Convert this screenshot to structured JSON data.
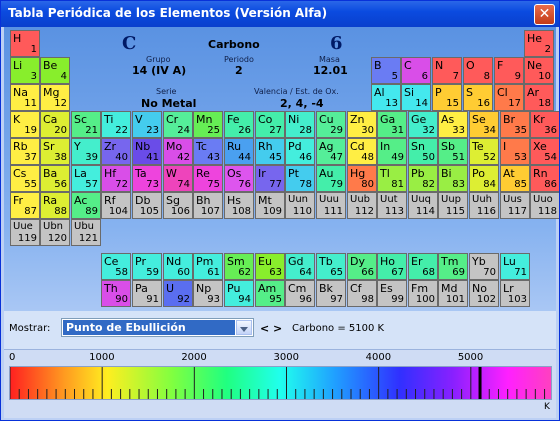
{
  "window": {
    "title": "Tabla Periódica de los Elementos (Versión Alfa)",
    "close_glyph": "✕"
  },
  "selected": {
    "symbol": "C",
    "name": "Carbono",
    "number": "6",
    "group_label": "Grupo",
    "group": "14 (IV A)",
    "period_label": "Periodo",
    "period": "2",
    "mass_label": "Masa",
    "mass": "12.01",
    "series_label": "Serie",
    "series": "No Metal",
    "valence_label": "Valencia / Est. de Ox.",
    "valence": "2, 4, -4"
  },
  "elements": [
    {
      "s": "H",
      "n": "1",
      "c": "#ff5a5a"
    },
    {
      "s": "He",
      "n": "2",
      "c": "#ff5a5a"
    },
    {
      "s": "Li",
      "n": "3",
      "c": "#88ee2c"
    },
    {
      "s": "Be",
      "n": "4",
      "c": "#88ee2c"
    },
    {
      "s": "B",
      "n": "5",
      "c": "#6a7cf3"
    },
    {
      "s": "C",
      "n": "6",
      "c": "#d94ee8"
    },
    {
      "s": "N",
      "n": "7",
      "c": "#ff5a5a"
    },
    {
      "s": "O",
      "n": "8",
      "c": "#ff5a5a"
    },
    {
      "s": "F",
      "n": "9",
      "c": "#ff5a5a"
    },
    {
      "s": "Ne",
      "n": "10",
      "c": "#ff5a5a"
    },
    {
      "s": "Na",
      "n": "11",
      "c": "#ffee44"
    },
    {
      "s": "Mg",
      "n": "12",
      "c": "#ffee44"
    },
    {
      "s": "Al",
      "n": "13",
      "c": "#44e8ee"
    },
    {
      "s": "Si",
      "n": "14",
      "c": "#44e8ee"
    },
    {
      "s": "P",
      "n": "15",
      "c": "#ffcc33"
    },
    {
      "s": "S",
      "n": "16",
      "c": "#ffcc33"
    },
    {
      "s": "Cl",
      "n": "17",
      "c": "#ff7a4a"
    },
    {
      "s": "Ar",
      "n": "18",
      "c": "#ff5a5a"
    },
    {
      "s": "K",
      "n": "19",
      "c": "#ffee44"
    },
    {
      "s": "Ca",
      "n": "20",
      "c": "#ddee33"
    },
    {
      "s": "Sc",
      "n": "21",
      "c": "#55ee88"
    },
    {
      "s": "Ti",
      "n": "22",
      "c": "#44eedd"
    },
    {
      "s": "V",
      "n": "23",
      "c": "#44ccee"
    },
    {
      "s": "Cr",
      "n": "24",
      "c": "#55ee99"
    },
    {
      "s": "Mn",
      "n": "25",
      "c": "#66ee55"
    },
    {
      "s": "Fe",
      "n": "26",
      "c": "#44eeaa"
    },
    {
      "s": "Co",
      "n": "27",
      "c": "#44eeaa"
    },
    {
      "s": "Ni",
      "n": "28",
      "c": "#44eecc"
    },
    {
      "s": "Cu",
      "n": "29",
      "c": "#55ee99"
    },
    {
      "s": "Zn",
      "n": "30",
      "c": "#ffee44"
    },
    {
      "s": "Ga",
      "n": "31",
      "c": "#55ee88"
    },
    {
      "s": "Ge",
      "n": "32",
      "c": "#44eecc"
    },
    {
      "s": "As",
      "n": "33",
      "c": "#ffee44"
    },
    {
      "s": "Se",
      "n": "34",
      "c": "#ffcc33"
    },
    {
      "s": "Br",
      "n": "35",
      "c": "#ff7a4a"
    },
    {
      "s": "Kr",
      "n": "36",
      "c": "#ff5a5a"
    },
    {
      "s": "Rb",
      "n": "37",
      "c": "#ffee44"
    },
    {
      "s": "Sr",
      "n": "38",
      "c": "#ddee33"
    },
    {
      "s": "Y",
      "n": "39",
      "c": "#44eecc"
    },
    {
      "s": "Zr",
      "n": "40",
      "c": "#7766ee"
    },
    {
      "s": "Nb",
      "n": "41",
      "c": "#6a4ce8"
    },
    {
      "s": "Mo",
      "n": "42",
      "c": "#d94ee8"
    },
    {
      "s": "Tc",
      "n": "43",
      "c": "#6a7cf3"
    },
    {
      "s": "Ru",
      "n": "44",
      "c": "#4aa0f0"
    },
    {
      "s": "Rh",
      "n": "45",
      "c": "#44ccee"
    },
    {
      "s": "Pd",
      "n": "46",
      "c": "#44eedd"
    },
    {
      "s": "Ag",
      "n": "47",
      "c": "#55ee99"
    },
    {
      "s": "Cd",
      "n": "48",
      "c": "#ffee44"
    },
    {
      "s": "In",
      "n": "49",
      "c": "#55ee88"
    },
    {
      "s": "Sn",
      "n": "50",
      "c": "#44eeaa"
    },
    {
      "s": "Sb",
      "n": "51",
      "c": "#55ee88"
    },
    {
      "s": "Te",
      "n": "52",
      "c": "#ddee33"
    },
    {
      "s": "I",
      "n": "53",
      "c": "#ff7a4a"
    },
    {
      "s": "Xe",
      "n": "54",
      "c": "#ff5a5a"
    },
    {
      "s": "Cs",
      "n": "55",
      "c": "#ffee44"
    },
    {
      "s": "Ba",
      "n": "56",
      "c": "#ddee33"
    },
    {
      "s": "La",
      "n": "57",
      "c": "#44eedd"
    },
    {
      "s": "Hf",
      "n": "72",
      "c": "#d94ee8"
    },
    {
      "s": "Ta",
      "n": "73",
      "c": "#ee44dd"
    },
    {
      "s": "W",
      "n": "74",
      "c": "#ee44bb"
    },
    {
      "s": "Re",
      "n": "75",
      "c": "#ee44dd"
    },
    {
      "s": "Os",
      "n": "76",
      "c": "#dd55ee"
    },
    {
      "s": "Ir",
      "n": "77",
      "c": "#7766ee"
    },
    {
      "s": "Pt",
      "n": "78",
      "c": "#44ccee"
    },
    {
      "s": "Au",
      "n": "79",
      "c": "#44eeaa"
    },
    {
      "s": "Hg",
      "n": "80",
      "c": "#ff7a4a"
    },
    {
      "s": "Tl",
      "n": "81",
      "c": "#99ee44"
    },
    {
      "s": "Pb",
      "n": "82",
      "c": "#99ee44"
    },
    {
      "s": "Bi",
      "n": "83",
      "c": "#99ee44"
    },
    {
      "s": "Po",
      "n": "84",
      "c": "#ddee33"
    },
    {
      "s": "At",
      "n": "85",
      "c": "#ffcc33"
    },
    {
      "s": "Rn",
      "n": "86",
      "c": "#ff5a5a"
    },
    {
      "s": "Fr",
      "n": "87",
      "c": "#ffee44"
    },
    {
      "s": "Ra",
      "n": "88",
      "c": "#ddee33"
    },
    {
      "s": "Ac",
      "n": "89",
      "c": "#55ee88"
    },
    {
      "s": "Rf",
      "n": "104",
      "c": "#c4c4c4"
    },
    {
      "s": "Db",
      "n": "105",
      "c": "#c4c4c4"
    },
    {
      "s": "Sg",
      "n": "106",
      "c": "#c4c4c4"
    },
    {
      "s": "Bh",
      "n": "107",
      "c": "#c4c4c4"
    },
    {
      "s": "Hs",
      "n": "108",
      "c": "#c4c4c4"
    },
    {
      "s": "Mt",
      "n": "109",
      "c": "#c4c4c4"
    },
    {
      "s": "Uun",
      "n": "110",
      "c": "#c4c4c4"
    },
    {
      "s": "Uuu",
      "n": "111",
      "c": "#c4c4c4"
    },
    {
      "s": "Uub",
      "n": "112",
      "c": "#c4c4c4"
    },
    {
      "s": "Uut",
      "n": "113",
      "c": "#c4c4c4"
    },
    {
      "s": "Uuq",
      "n": "114",
      "c": "#c4c4c4"
    },
    {
      "s": "Uup",
      "n": "115",
      "c": "#c4c4c4"
    },
    {
      "s": "Uuh",
      "n": "116",
      "c": "#c4c4c4"
    },
    {
      "s": "Uus",
      "n": "117",
      "c": "#c4c4c4"
    },
    {
      "s": "Uuo",
      "n": "118",
      "c": "#c4c4c4"
    },
    {
      "s": "Uue",
      "n": "119",
      "c": "#c4c4c4"
    },
    {
      "s": "Ubn",
      "n": "120",
      "c": "#c4c4c4"
    },
    {
      "s": "Ubu",
      "n": "121",
      "c": "#c4c4c4"
    },
    {
      "s": "Ce",
      "n": "58",
      "c": "#44eedd"
    },
    {
      "s": "Pr",
      "n": "59",
      "c": "#44eedd"
    },
    {
      "s": "Nd",
      "n": "60",
      "c": "#44eedd"
    },
    {
      "s": "Pm",
      "n": "61",
      "c": "#44eedd"
    },
    {
      "s": "Sm",
      "n": "62",
      "c": "#66ee55"
    },
    {
      "s": "Eu",
      "n": "63",
      "c": "#88ee2c"
    },
    {
      "s": "Gd",
      "n": "64",
      "c": "#44eecc"
    },
    {
      "s": "Tb",
      "n": "65",
      "c": "#44eecc"
    },
    {
      "s": "Dy",
      "n": "66",
      "c": "#55ee88"
    },
    {
      "s": "Ho",
      "n": "67",
      "c": "#44eeaa"
    },
    {
      "s": "Er",
      "n": "68",
      "c": "#44eeaa"
    },
    {
      "s": "Tm",
      "n": "69",
      "c": "#55ee88"
    },
    {
      "s": "Yb",
      "n": "70",
      "c": "#c4c4c4"
    },
    {
      "s": "Lu",
      "n": "71",
      "c": "#44eedd"
    },
    {
      "s": "Th",
      "n": "90",
      "c": "#d94ee8"
    },
    {
      "s": "Pa",
      "n": "91",
      "c": "#c4c4c4"
    },
    {
      "s": "U",
      "n": "92",
      "c": "#5a6ef0"
    },
    {
      "s": "Np",
      "n": "93",
      "c": "#c4c4c4"
    },
    {
      "s": "Pu",
      "n": "94",
      "c": "#44eedd"
    },
    {
      "s": "Am",
      "n": "95",
      "c": "#55ee88"
    },
    {
      "s": "Cm",
      "n": "96",
      "c": "#c4c4c4"
    },
    {
      "s": "Bk",
      "n": "97",
      "c": "#c4c4c4"
    },
    {
      "s": "Cf",
      "n": "98",
      "c": "#c4c4c4"
    },
    {
      "s": "Es",
      "n": "99",
      "c": "#c4c4c4"
    },
    {
      "s": "Fm",
      "n": "100",
      "c": "#c4c4c4"
    },
    {
      "s": "Md",
      "n": "101",
      "c": "#c4c4c4"
    },
    {
      "s": "No",
      "n": "102",
      "c": "#c4c4c4"
    },
    {
      "s": "Lr",
      "n": "103",
      "c": "#c4c4c4"
    }
  ],
  "controls": {
    "show_label": "Mostrar:",
    "property_selected": "Punto de Ebullición",
    "nav_glyph": "< >",
    "readout": "Carbono = 5100 K"
  },
  "scale": {
    "ticks": [
      "0",
      "1000",
      "2000",
      "3000",
      "4000",
      "5000"
    ],
    "tick_values": [
      0,
      1000,
      2000,
      3000,
      4000,
      5000
    ],
    "max": 5870,
    "unit": "K",
    "marker_value": 5100
  }
}
